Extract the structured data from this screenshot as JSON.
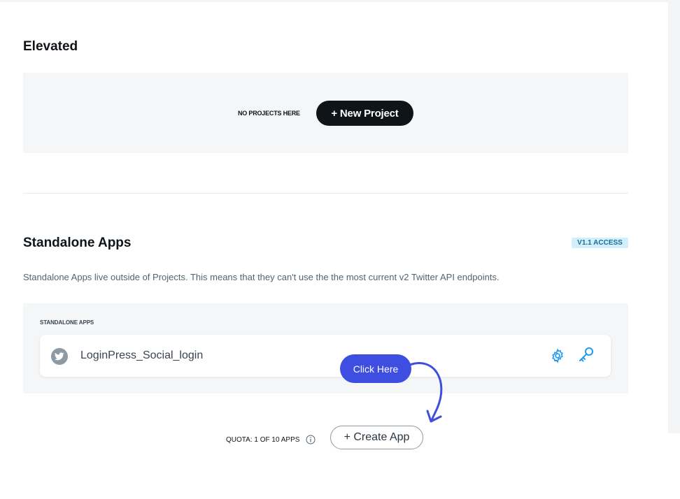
{
  "elevated": {
    "title": "Elevated",
    "empty_text": "NO PROJECTS HERE",
    "new_project_label": "+ New Project"
  },
  "standalone": {
    "title": "Standalone Apps",
    "access_badge": "V1.1 ACCESS",
    "description": "Standalone Apps live outside of Projects. This means that they can't use the the most current v2 Twitter API endpoints.",
    "list_label": "STANDALONE APPS",
    "apps": [
      {
        "name": "LoginPress_Social_login",
        "icons": [
          "gear-icon",
          "key-icon"
        ]
      }
    ]
  },
  "annotation": {
    "bubble_text": "Click Here",
    "color": "#3d4ee0"
  },
  "footer": {
    "quota_text": "QUOTA: 1 OF 10 APPS",
    "create_app_label": "+ Create App"
  }
}
